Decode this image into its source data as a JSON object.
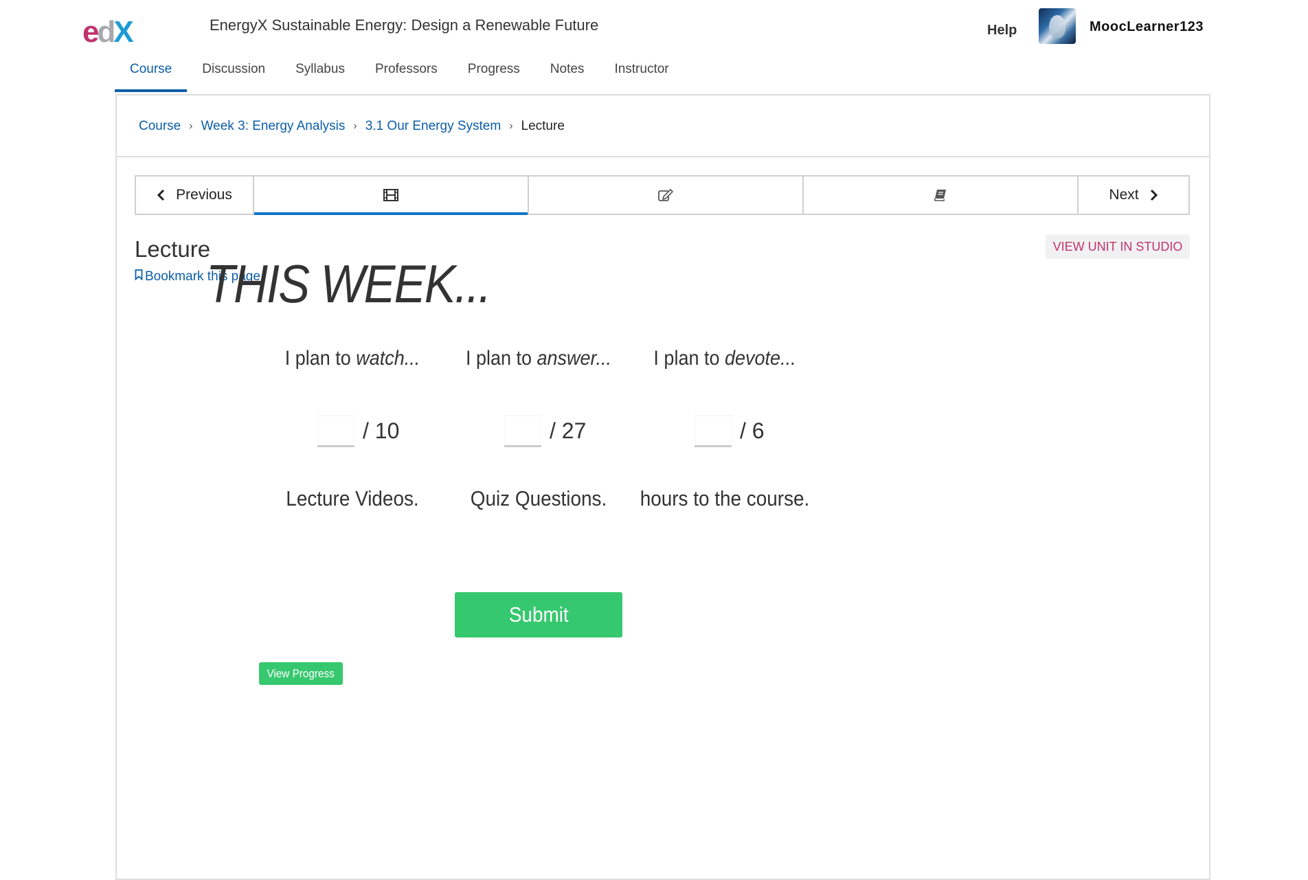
{
  "header": {
    "logo": {
      "e": "e",
      "d": "d",
      "x": "X"
    },
    "course_title": "EnergyX Sustainable Energy: Design a Renewable Future",
    "help_label": "Help",
    "username": "MoocLearner123"
  },
  "tabs": [
    {
      "label": "Course"
    },
    {
      "label": "Discussion"
    },
    {
      "label": "Syllabus"
    },
    {
      "label": "Professors"
    },
    {
      "label": "Progress"
    },
    {
      "label": "Notes"
    },
    {
      "label": "Instructor"
    }
  ],
  "breadcrumb": [
    {
      "label": "Course"
    },
    {
      "label": "Week 3: Energy Analysis"
    },
    {
      "label": "3.1 Our Energy System"
    },
    {
      "label": "Lecture"
    }
  ],
  "breadcrumb_separator": "›",
  "sequence_nav": {
    "previous_label": "Previous",
    "next_label": "Next",
    "units": [
      {
        "icon": "video-icon",
        "active": true
      },
      {
        "icon": "edit-icon",
        "active": false
      },
      {
        "icon": "book-icon",
        "active": false
      }
    ]
  },
  "unit": {
    "title": "Lecture",
    "bookmark_label": "Bookmark this page",
    "studio_label": "VIEW UNIT IN STUDIO"
  },
  "content": {
    "heading": "THIS WEEK...",
    "columns": [
      {
        "plan_prefix": "I plan to ",
        "plan_verb": "watch...",
        "value": "",
        "total": "/ 10",
        "noun": "Lecture Videos."
      },
      {
        "plan_prefix": "I plan to ",
        "plan_verb": "answer...",
        "value": "",
        "total": "/ 27",
        "noun": "Quiz Questions."
      },
      {
        "plan_prefix": "I plan to ",
        "plan_verb": "devote...",
        "value": "",
        "total": "/ 6",
        "noun": "hours to the course."
      }
    ],
    "submit_label": "Submit",
    "view_progress_label": "View Progress"
  },
  "colors": {
    "link_blue": "#0b5ea8",
    "tab_active_blue": "#0b75c7",
    "studio_pink": "#c0336e",
    "button_green": "#36c86e"
  }
}
